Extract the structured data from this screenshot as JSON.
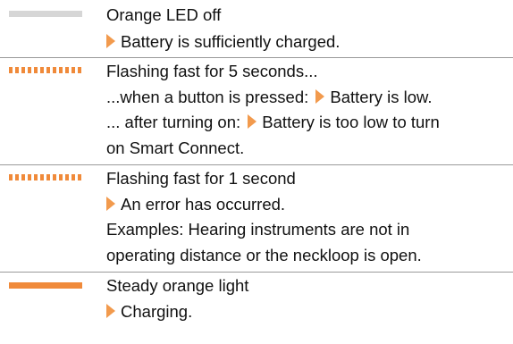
{
  "colors": {
    "orange": "#f08a3a",
    "led_off": "#d6d6d6",
    "separator": "#9a9a9a"
  },
  "rows": [
    {
      "led": "off",
      "lines": [
        "Orange LED off",
        "Battery is sufficiently charged."
      ]
    },
    {
      "led": "flashing",
      "title": "Flashing fast for 5 seconds...",
      "l2_prefix": "...when a button is pressed:",
      "l2_result": "Battery is low.",
      "l3_prefix": "... after turning on:",
      "l3_result": "Battery is too low to turn",
      "l4": "on Smart Connect."
    },
    {
      "led": "flashing",
      "lines": [
        "Flashing fast for 1 second",
        "An error has occurred.",
        "Examples: Hearing instruments are not in",
        "operating distance or the neckloop is open."
      ]
    },
    {
      "led": "steady",
      "lines": [
        "Steady orange light",
        "Charging."
      ]
    }
  ]
}
